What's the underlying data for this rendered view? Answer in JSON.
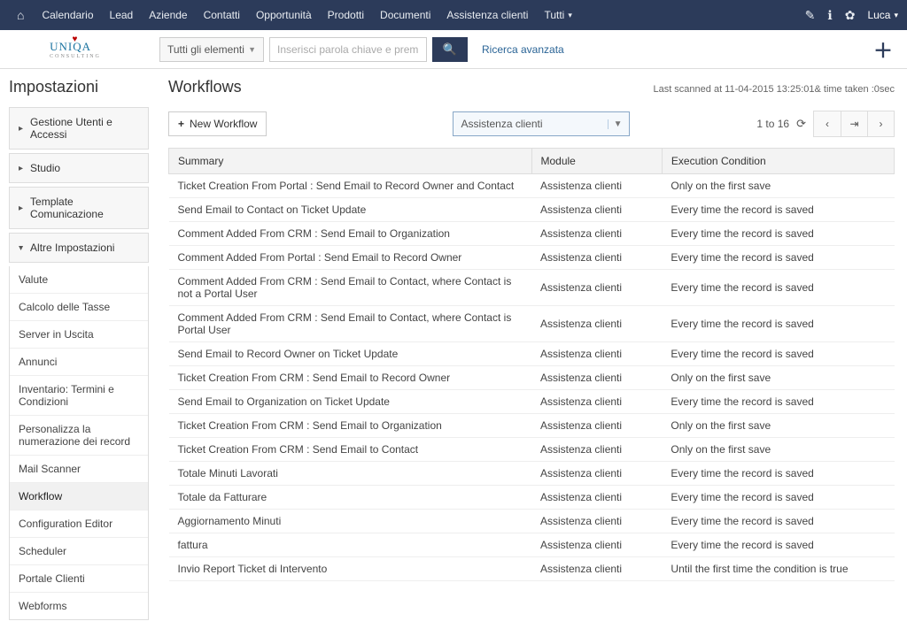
{
  "topnav": {
    "items": [
      "Calendario",
      "Lead",
      "Aziende",
      "Contatti",
      "Opportunità",
      "Prodotti",
      "Documenti",
      "Assistenza clienti",
      "Tutti"
    ],
    "user": "Luca"
  },
  "logo": {
    "main": "UNIQA",
    "sub": "CONSULTING"
  },
  "search": {
    "scope": "Tutti gli elementi",
    "placeholder": "Inserisci parola chiave e premi invio",
    "advanced": "Ricerca avanzata"
  },
  "sidebar": {
    "title": "Impostazioni",
    "sections": [
      {
        "label": "Gestione Utenti e Accessi",
        "expanded": false
      },
      {
        "label": "Studio",
        "expanded": false
      },
      {
        "label": "Template Comunicazione",
        "expanded": false
      },
      {
        "label": "Altre Impostazioni",
        "expanded": true
      }
    ],
    "altre_items": [
      "Valute",
      "Calcolo delle Tasse",
      "Server in Uscita",
      "Annunci",
      "Inventario: Termini e Condizioni",
      "Personalizza la numerazione dei record",
      "Mail Scanner",
      "Workflow",
      "Configuration Editor",
      "Scheduler",
      "Portale Clienti",
      "Webforms"
    ],
    "active_item": "Workflow"
  },
  "main": {
    "title": "Workflows",
    "scan_info": "Last scanned at 11-04-2015 13:25:01& time taken :0sec",
    "new_button": "New Workflow",
    "module_selected": "Assistenza clienti",
    "pager": "1 to 16",
    "columns": {
      "summary": "Summary",
      "module": "Module",
      "condition": "Execution Condition"
    },
    "rows": [
      {
        "summary": "Ticket Creation From Portal : Send Email to Record Owner and Contact",
        "module": "Assistenza clienti",
        "condition": "Only on the first save"
      },
      {
        "summary": "Send Email to Contact on Ticket Update",
        "module": "Assistenza clienti",
        "condition": "Every time the record is saved"
      },
      {
        "summary": "Comment Added From CRM : Send Email to Organization",
        "module": "Assistenza clienti",
        "condition": "Every time the record is saved"
      },
      {
        "summary": "Comment Added From Portal : Send Email to Record Owner",
        "module": "Assistenza clienti",
        "condition": "Every time the record is saved"
      },
      {
        "summary": "Comment Added From CRM : Send Email to Contact, where Contact is not a Portal User",
        "module": "Assistenza clienti",
        "condition": "Every time the record is saved"
      },
      {
        "summary": "Comment Added From CRM : Send Email to Contact, where Contact is Portal User",
        "module": "Assistenza clienti",
        "condition": "Every time the record is saved"
      },
      {
        "summary": "Send Email to Record Owner on Ticket Update",
        "module": "Assistenza clienti",
        "condition": "Every time the record is saved"
      },
      {
        "summary": "Ticket Creation From CRM : Send Email to Record Owner",
        "module": "Assistenza clienti",
        "condition": "Only on the first save"
      },
      {
        "summary": "Send Email to Organization on Ticket Update",
        "module": "Assistenza clienti",
        "condition": "Every time the record is saved"
      },
      {
        "summary": "Ticket Creation From CRM : Send Email to Organization",
        "module": "Assistenza clienti",
        "condition": "Only on the first save"
      },
      {
        "summary": "Ticket Creation From CRM : Send Email to Contact",
        "module": "Assistenza clienti",
        "condition": "Only on the first save"
      },
      {
        "summary": "Totale Minuti Lavorati",
        "module": "Assistenza clienti",
        "condition": "Every time the record is saved"
      },
      {
        "summary": "Totale da Fatturare",
        "module": "Assistenza clienti",
        "condition": "Every time the record is saved"
      },
      {
        "summary": "Aggiornamento Minuti",
        "module": "Assistenza clienti",
        "condition": "Every time the record is saved"
      },
      {
        "summary": "fattura",
        "module": "Assistenza clienti",
        "condition": "Every time the record is saved"
      },
      {
        "summary": "Invio Report Ticket di Intervento",
        "module": "Assistenza clienti",
        "condition": "Until the first time the condition is true"
      }
    ]
  }
}
